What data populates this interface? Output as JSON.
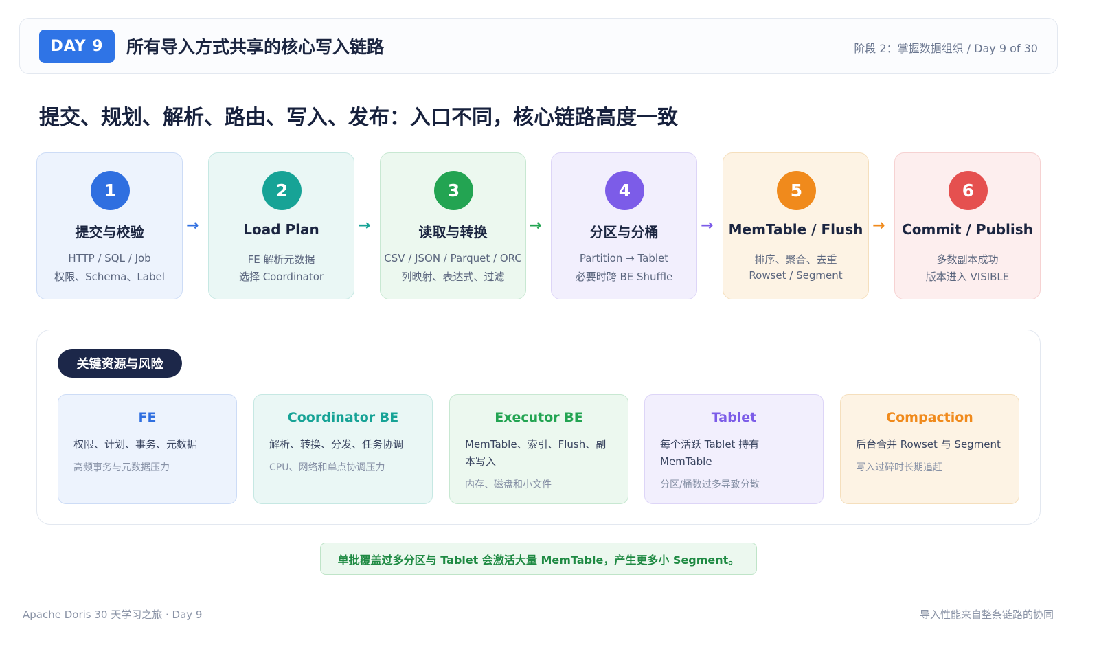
{
  "header": {
    "day_badge": "DAY 9",
    "title": "所有导入方式共享的核心写入链路",
    "stage": "阶段 2：掌握数据组织 / Day 9 of 30"
  },
  "main_heading": "提交、规划、解析、路由、写入、发布：入口不同，核心链路高度一致",
  "steps": [
    {
      "num": "1",
      "title": "提交与校验",
      "line1": "HTTP / SQL / Job",
      "line2": "权限、Schema、Label",
      "color": "#2f6fe0",
      "bg": "#edf3fd",
      "border": "#cddcf6"
    },
    {
      "num": "2",
      "title": "Load Plan",
      "line1": "FE 解析元数据",
      "line2": "选择 Coordinator",
      "color": "#17a396",
      "bg": "#eaf7f5",
      "border": "#c6e8e3"
    },
    {
      "num": "3",
      "title": "读取与转换",
      "line1": "CSV / JSON / Parquet / ORC",
      "line2": "列映射、表达式、过滤",
      "color": "#23a452",
      "bg": "#ecf8ef",
      "border": "#c8e8d2"
    },
    {
      "num": "4",
      "title": "分区与分桶",
      "line1": "Partition → Tablet",
      "line2": "必要时跨 BE Shuffle",
      "color": "#7c5ce8",
      "bg": "#f2effd",
      "border": "#ddd5f7"
    },
    {
      "num": "5",
      "title": "MemTable / Flush",
      "line1": "排序、聚合、去重",
      "line2": "Rowset / Segment",
      "color": "#f08a1c",
      "bg": "#fdf3e4",
      "border": "#f5dfbd"
    },
    {
      "num": "6",
      "title": "Commit / Publish",
      "line1": "多数副本成功",
      "line2": "版本进入 VISIBLE",
      "color": "#e5504f",
      "bg": "#fdeeee",
      "border": "#f6d2d2"
    }
  ],
  "arrows": [
    {
      "glyph": "→",
      "color": "#2f6fe0"
    },
    {
      "glyph": "→",
      "color": "#17a396"
    },
    {
      "glyph": "→",
      "color": "#23a452"
    },
    {
      "glyph": "→",
      "color": "#7c5ce8"
    },
    {
      "glyph": "→",
      "color": "#f08a1c"
    }
  ],
  "resources": {
    "pill": "关键资源与风险",
    "cards": [
      {
        "title": "FE",
        "desc": "权限、计划、事务、元数据",
        "note": "高频事务与元数据压力",
        "color": "#2f6fe0",
        "bg": "#edf3fd",
        "border": "#cddcf6"
      },
      {
        "title": "Coordinator BE",
        "desc": "解析、转换、分发、任务协调",
        "note": "CPU、网络和单点协调压力",
        "color": "#17a396",
        "bg": "#eaf7f5",
        "border": "#c6e8e3"
      },
      {
        "title": "Executor BE",
        "desc": "MemTable、索引、Flush、副本写入",
        "note": "内存、磁盘和小文件",
        "color": "#23a452",
        "bg": "#ecf8ef",
        "border": "#c8e8d2"
      },
      {
        "title": "Tablet",
        "desc": "每个活跃 Tablet 持有 MemTable",
        "note": "分区/桶数过多导致分散",
        "color": "#7c5ce8",
        "bg": "#f2effd",
        "border": "#ddd5f7"
      },
      {
        "title": "Compaction",
        "desc": "后台合并 Rowset 与 Segment",
        "note": "写入过碎时长期追赶",
        "color": "#f08a1c",
        "bg": "#fdf3e4",
        "border": "#f5dfbd"
      }
    ]
  },
  "bottom_note": "单批覆盖过多分区与 Tablet 会激活大量 MemTable，产生更多小 Segment。",
  "footer": {
    "left": "Apache Doris 30 天学习之旅 · Day 9",
    "right": "导入性能来自整条链路的协同"
  }
}
